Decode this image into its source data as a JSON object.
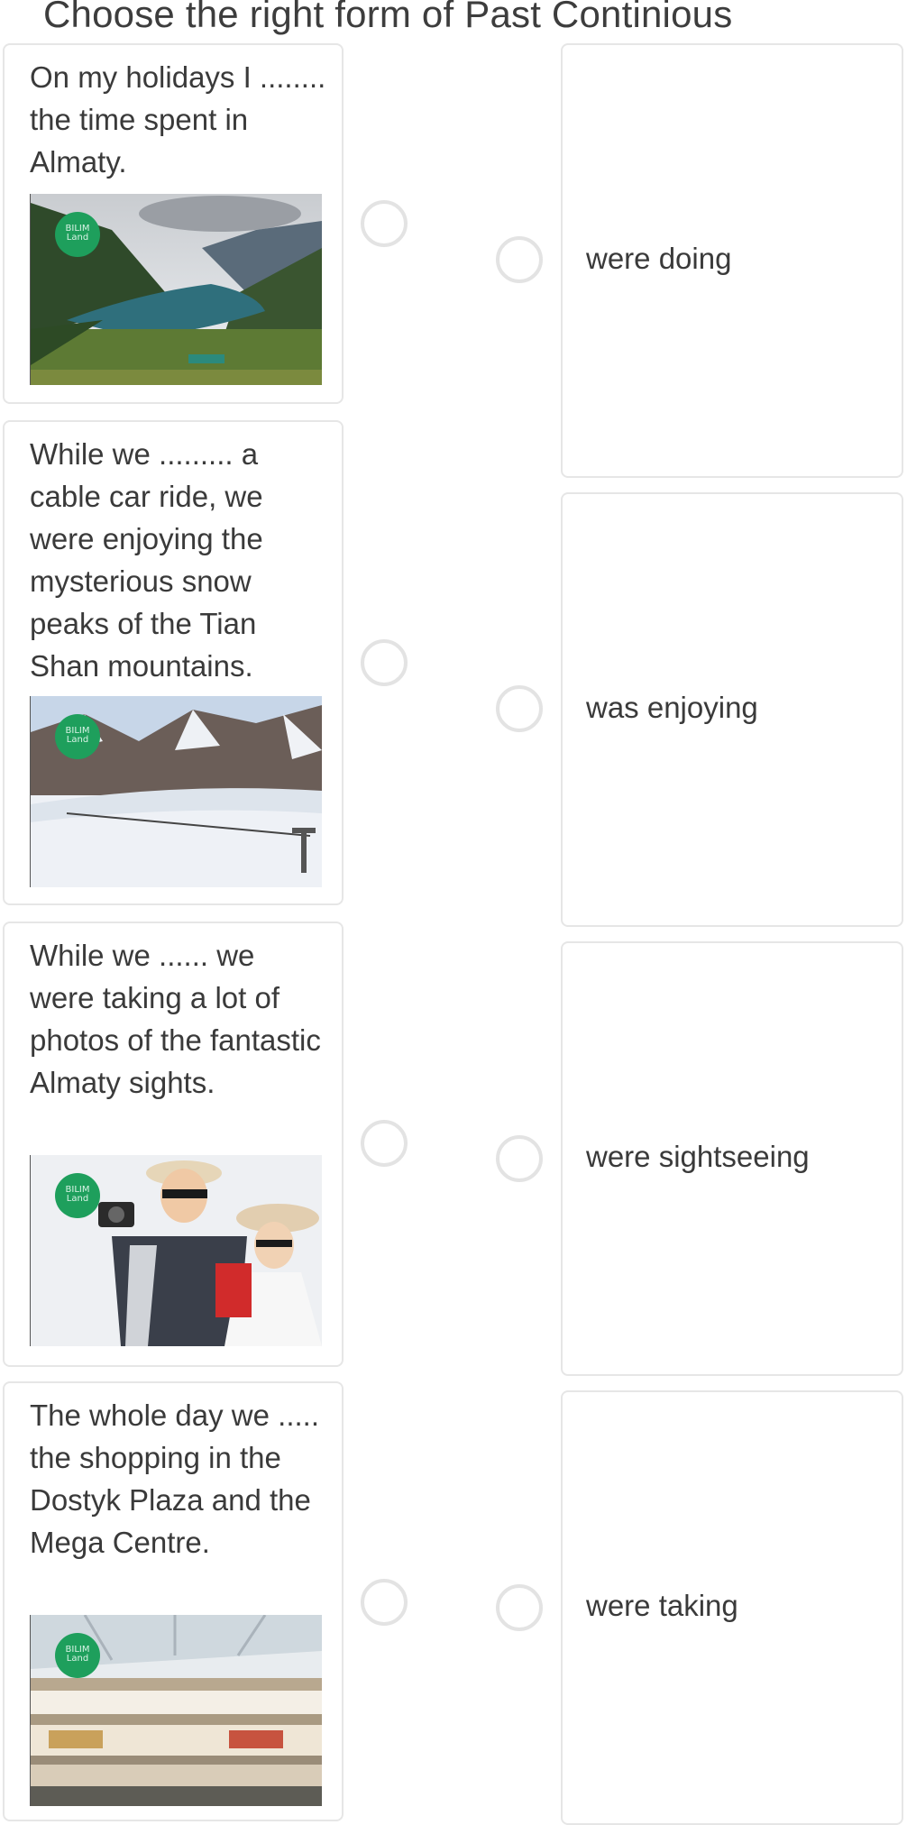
{
  "title": "Choose the right form of Past Continious",
  "questions": [
    {
      "text": "On my holidays I ........ the time spent in Almaty.",
      "image": "mountain-lake-photo",
      "logo": "BILIM Land"
    },
    {
      "text": "While we ......... a cable car ride, we were enjoying the mysterious snow peaks of the Tian Shan mountains.",
      "image": "snowy-mountains-cable-car-photo",
      "logo": "BILIM Land"
    },
    {
      "text": "While we ...... we were taking a lot of photos of the fantastic Almaty sights.",
      "image": "tourists-with-camera-photo",
      "logo": "BILIM Land"
    },
    {
      "text": "The whole day we ..... the shopping in the Dostyk Plaza and the Mega Centre.",
      "image": "shopping-mall-interior-photo",
      "logo": "BILIM Land"
    }
  ],
  "answers": [
    {
      "text": "were doing"
    },
    {
      "text": "was enjoying"
    },
    {
      "text": "were sightseeing"
    },
    {
      "text": "were taking"
    }
  ],
  "colors": {
    "card_border": "#e6e6e6",
    "radio_border": "#e3e3e3",
    "logo_green": "#1e9f5c",
    "text": "#3a3a3a"
  }
}
